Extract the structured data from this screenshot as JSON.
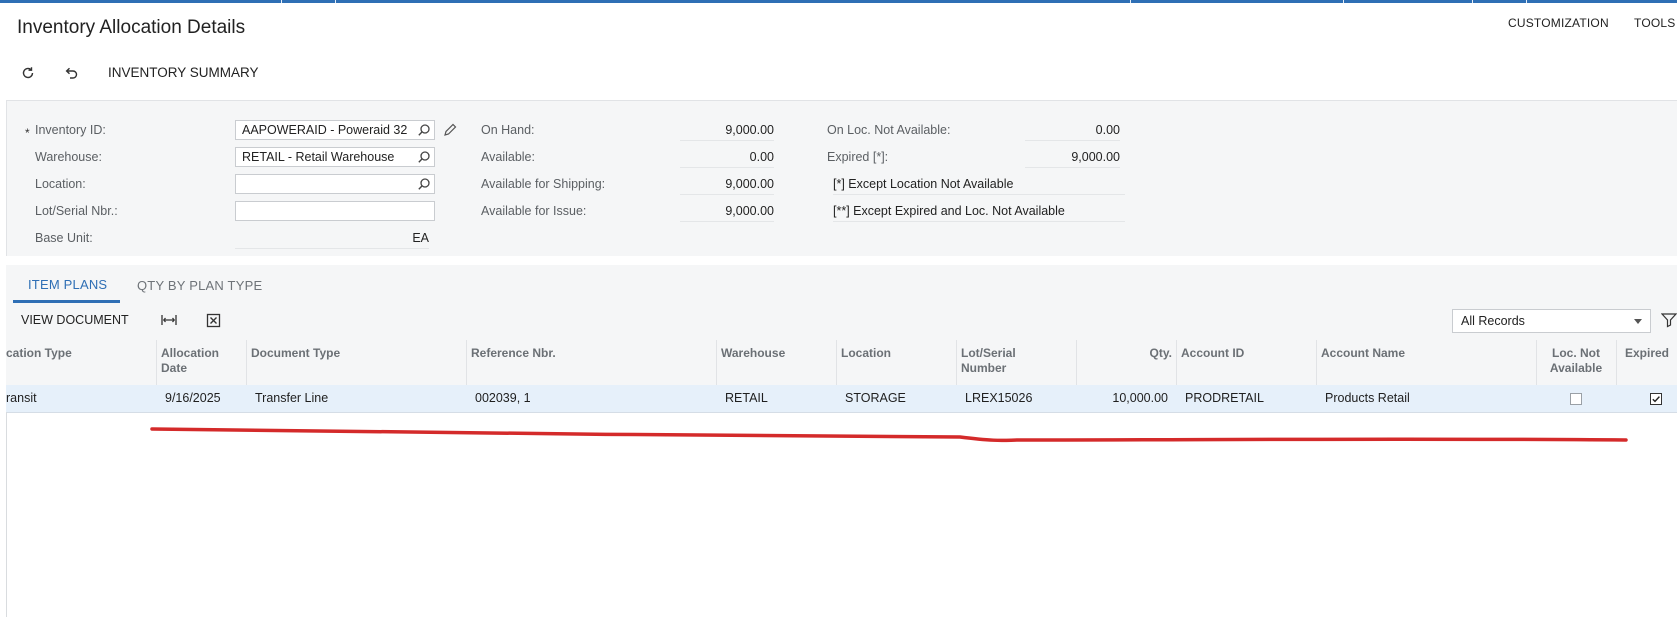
{
  "header": {
    "title": "Inventory Allocation Details",
    "links": [
      "CUSTOMIZATION",
      "TOOLS"
    ]
  },
  "toolbar": {
    "refresh_icon": "refresh-icon",
    "undo_icon": "undo-icon",
    "summary_label": "INVENTORY SUMMARY"
  },
  "form": {
    "inventory_id": {
      "label": "Inventory ID:",
      "value": "AAPOWERAID - Poweraid 32",
      "required_mark": "*"
    },
    "warehouse": {
      "label": "Warehouse:",
      "value": "RETAIL - Retail Warehouse"
    },
    "location": {
      "label": "Location:",
      "value": ""
    },
    "lot_serial": {
      "label": "Lot/Serial Nbr.:",
      "value": ""
    },
    "base_unit": {
      "label": "Base Unit:",
      "value": "EA"
    },
    "on_hand": {
      "label": "On Hand:",
      "value": "9,000.00"
    },
    "available": {
      "label": "Available:",
      "value": "0.00"
    },
    "available_shipping": {
      "label": "Available for Shipping:",
      "value": "9,000.00"
    },
    "available_issue": {
      "label": "Available for Issue:",
      "value": "9,000.00"
    },
    "on_loc_not_available": {
      "label": "On Loc. Not Available:",
      "value": "0.00"
    },
    "expired": {
      "label": "Expired [*]:",
      "value": "9,000.00"
    },
    "note1": "[*]  Except Location Not Available",
    "note2": "[**] Except Expired and  Loc. Not Available"
  },
  "tabs": [
    {
      "label": "ITEM PLANS",
      "active": true
    },
    {
      "label": "QTY BY PLAN TYPE",
      "active": false
    }
  ],
  "grid_toolbar": {
    "view_document": "VIEW DOCUMENT",
    "fit_icon": "fit-columns-icon",
    "excel_icon": "export-excel-icon",
    "filter_value": "All Records",
    "filter_icon": "filter-icon"
  },
  "grid": {
    "columns": [
      {
        "line1": "cation Type",
        "line2": ""
      },
      {
        "line1": "Allocation",
        "line2": "Date"
      },
      {
        "line1": "Document Type",
        "line2": ""
      },
      {
        "line1": "Reference Nbr.",
        "line2": ""
      },
      {
        "line1": "Warehouse",
        "line2": ""
      },
      {
        "line1": "Location",
        "line2": ""
      },
      {
        "line1": "Lot/Serial",
        "line2": "Number"
      },
      {
        "line1": "Qty.",
        "line2": ""
      },
      {
        "line1": "Account ID",
        "line2": ""
      },
      {
        "line1": "Account Name",
        "line2": ""
      },
      {
        "line1": "Loc. Not",
        "line2": "Available"
      },
      {
        "line1": "Expired",
        "line2": ""
      }
    ],
    "rows": [
      {
        "allocation_type": "ransit",
        "allocation_date": "9/16/2025",
        "document_type": "Transfer Line",
        "reference_nbr": "002039, 1",
        "warehouse": "RETAIL",
        "location": "STORAGE",
        "lot_serial": "LREX15026",
        "qty": "10,000.00",
        "account_id": "PRODRETAIL",
        "account_name": "Products Retail",
        "loc_not_available": false,
        "expired": true
      }
    ]
  },
  "annotation": {
    "color": "#d42a2a"
  }
}
